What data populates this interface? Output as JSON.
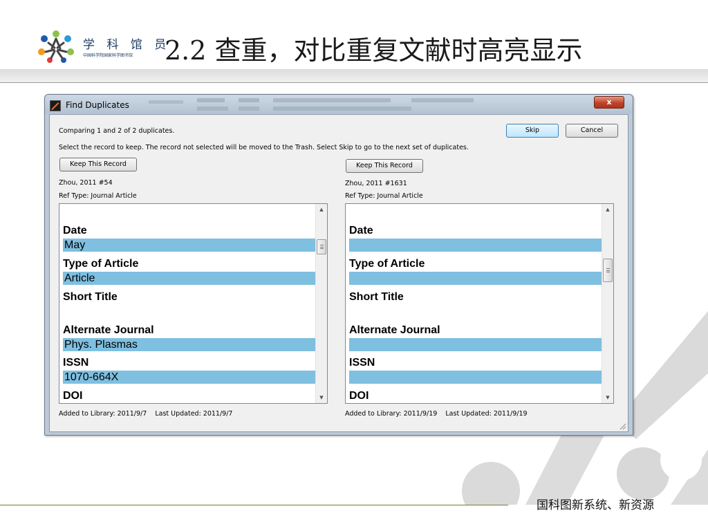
{
  "slide": {
    "brand_title": "学 科 馆 员",
    "brand_subtitle": "中国科学院国家科学图书馆",
    "title": "2.2 查重，对比重复文献时高亮显示",
    "footer": "国科图新系统、新资源"
  },
  "dialog": {
    "title": "Find Duplicates",
    "app_icon": "endnote-app-icon",
    "close_label": "x",
    "status_text": "Comparing 1 and 2 of 2 duplicates.",
    "instruction_text": "Select the record to keep. The record not selected will be moved to the Trash. Select Skip to go to the next set of duplicates.",
    "skip_label": "Skip",
    "cancel_label": "Cancel",
    "left": {
      "keep_label": "Keep This Record",
      "record_id": "Zhou, 2011 #54",
      "ref_type": "Ref Type: Journal Article",
      "fields": [
        {
          "label": "Date",
          "value": "May"
        },
        {
          "label": "Type of Article",
          "value": "Article"
        },
        {
          "label": "Short Title"
        },
        {
          "label": "Alternate Journal",
          "value": "Phys. Plasmas"
        },
        {
          "label": "ISSN",
          "value": "1070-664X"
        },
        {
          "label": "DOI"
        }
      ],
      "footer": "Added to Library: 2011/9/7    Last Updated: 2011/9/7"
    },
    "right": {
      "keep_label": "Keep This Record",
      "record_id": "Zhou, 2011 #1631",
      "ref_type": "Ref Type: Journal Article",
      "fields": [
        {
          "label": "Date",
          "value": ""
        },
        {
          "label": "Type of Article",
          "value": ""
        },
        {
          "label": "Short Title"
        },
        {
          "label": "Alternate Journal",
          "value": ""
        },
        {
          "label": "ISSN",
          "value": ""
        },
        {
          "label": "DOI"
        }
      ],
      "footer": "Added to Library: 2011/9/19    Last Updated: 2011/9/19"
    },
    "highlight_color": "#7fbfe0"
  }
}
